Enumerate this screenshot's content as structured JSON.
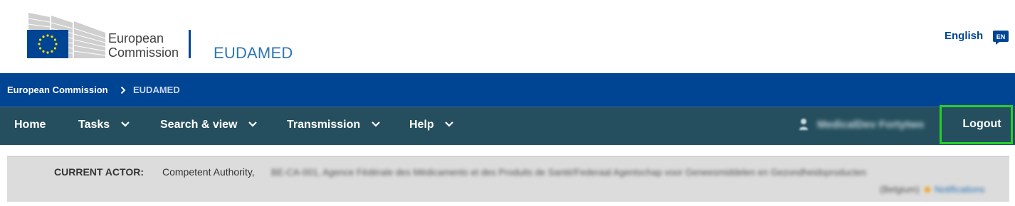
{
  "header": {
    "logo_line1": "European",
    "logo_line2": "Commission",
    "site_name": "EUDAMED",
    "language": "English",
    "language_code": "EN"
  },
  "breadcrumb": {
    "items": [
      "European Commission",
      "EUDAMED"
    ]
  },
  "nav": {
    "items": [
      {
        "label": "Home",
        "has_dropdown": false
      },
      {
        "label": "Tasks",
        "has_dropdown": true
      },
      {
        "label": "Search & view",
        "has_dropdown": true
      },
      {
        "label": "Transmission",
        "has_dropdown": true
      },
      {
        "label": "Help",
        "has_dropdown": true
      }
    ],
    "user_name": "MedicalDev Fortytwo",
    "logout_label": "Logout"
  },
  "actor": {
    "label": "CURRENT ACTOR:",
    "value": "Competent Authority,",
    "details_blurred": "BE-CA-001, Agence Fédérale des Médicaments et des Produits de Santé/Federaal Agentschap voor Geneesmiddelen en Gezondheidsproducten",
    "country_blurred": "(Belgium)",
    "notifications_label": "Notifications"
  },
  "colors": {
    "breadcrumb_bg": "#004494",
    "nav_bg": "#254f5e",
    "logout_highlight": "#24d02a",
    "site_name": "#2e76b4",
    "actor_bg": "#dcdcdc"
  }
}
